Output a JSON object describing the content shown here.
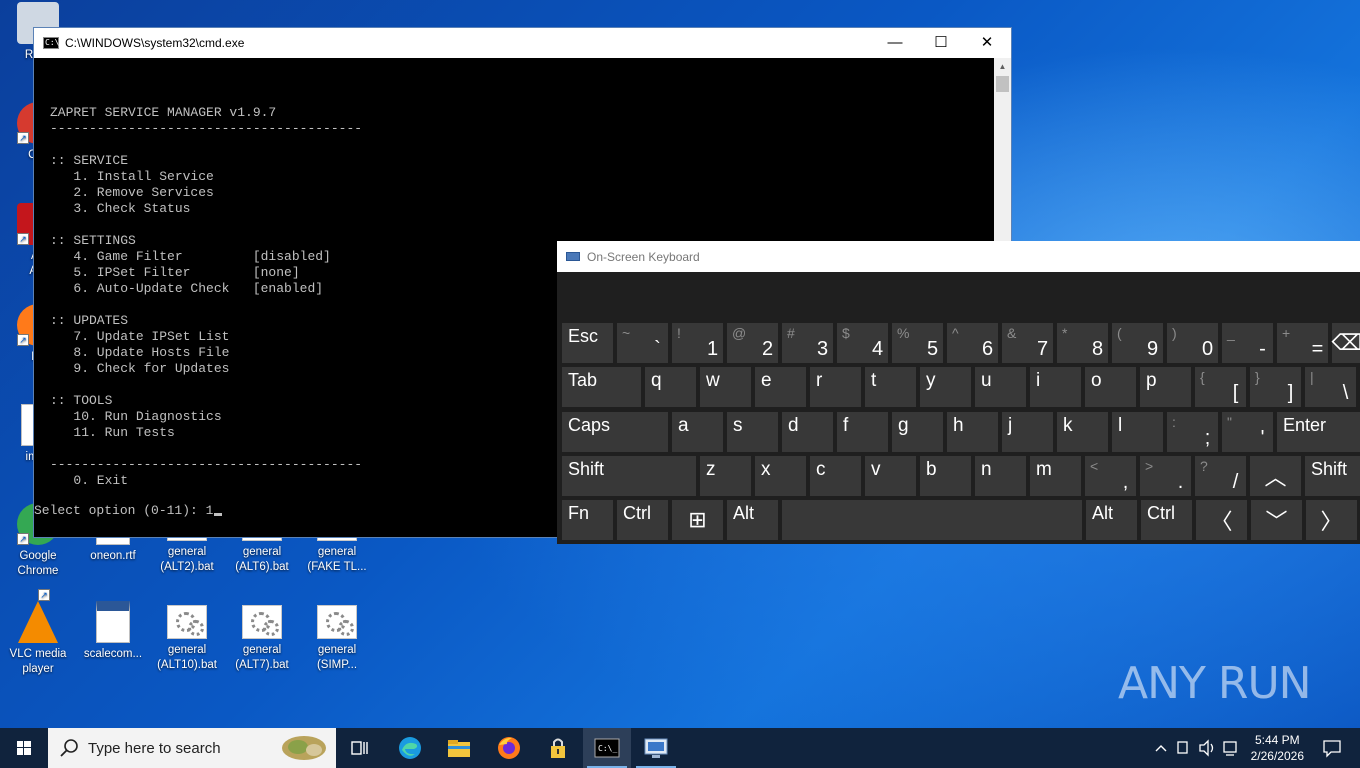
{
  "desktop": {
    "icons": [
      {
        "name": "recycle-bin",
        "label": "Recy",
        "type": "recycle"
      },
      {
        "name": "ccleaner",
        "label": "CCI",
        "type": "app"
      },
      {
        "name": "adobe-acrobat",
        "label": "Ad\nAcr",
        "type": "app"
      },
      {
        "name": "firefox",
        "label": "Fir",
        "type": "app"
      },
      {
        "name": "impo",
        "label": "impo",
        "type": "doc"
      },
      {
        "name": "google-chrome",
        "label": "Google\nChrome",
        "type": "app"
      },
      {
        "name": "oneon-rtf",
        "label": "oneon.rtf",
        "type": "doc"
      },
      {
        "name": "general-alt2",
        "label": "general\n(ALT2).bat",
        "type": "bat"
      },
      {
        "name": "general-alt6",
        "label": "general\n(ALT6).bat",
        "type": "bat"
      },
      {
        "name": "general-fake-tl",
        "label": "general\n(FAKE TL...",
        "type": "bat"
      },
      {
        "name": "vlc",
        "label": "VLC media\nplayer",
        "type": "app"
      },
      {
        "name": "scalecom",
        "label": "scalecom...",
        "type": "word"
      },
      {
        "name": "general-alt10",
        "label": "general\n(ALT10).bat",
        "type": "bat"
      },
      {
        "name": "general-alt7",
        "label": "general\n(ALT7).bat",
        "type": "bat"
      },
      {
        "name": "general-simp",
        "label": "general\n(SIMP...",
        "type": "bat"
      }
    ],
    "watermark": "ANY RUN"
  },
  "cmd": {
    "title": "C:\\WINDOWS\\system32\\cmd.exe",
    "lines": [
      "ZAPRET SERVICE MANAGER v1.9.7",
      "----------------------------------------",
      "",
      ":: SERVICE",
      "   1. Install Service",
      "   2. Remove Services",
      "   3. Check Status",
      "",
      ":: SETTINGS",
      "   4. Game Filter         [disabled]",
      "   5. IPSet Filter        [none]",
      "   6. Auto-Update Check   [enabled]",
      "",
      ":: UPDATES",
      "   7. Update IPSet List",
      "   8. Update Hosts File",
      "   9. Check for Updates",
      "",
      ":: TOOLS",
      "   10. Run Diagnostics",
      "   11. Run Tests",
      "",
      "----------------------------------------",
      "   0. Exit"
    ],
    "prompt": "Select option (0-11): ",
    "input_value": "1"
  },
  "osk": {
    "title": "On-Screen Keyboard",
    "rows": [
      [
        {
          "id": "esc",
          "main": "Esc"
        },
        {
          "id": "backtick",
          "top": "~",
          "bot": "`"
        },
        {
          "id": "1",
          "top": "!",
          "bot": "1"
        },
        {
          "id": "2",
          "top": "@",
          "bot": "2"
        },
        {
          "id": "3",
          "top": "#",
          "bot": "3"
        },
        {
          "id": "4",
          "top": "$",
          "bot": "4"
        },
        {
          "id": "5",
          "top": "%",
          "bot": "5"
        },
        {
          "id": "6",
          "top": "^",
          "bot": "6"
        },
        {
          "id": "7",
          "top": "&",
          "bot": "7"
        },
        {
          "id": "8",
          "top": "*",
          "bot": "8"
        },
        {
          "id": "9",
          "top": "(",
          "bot": "9"
        },
        {
          "id": "0",
          "top": ")",
          "bot": "0"
        },
        {
          "id": "minus",
          "top": "_",
          "bot": "-"
        },
        {
          "id": "equals",
          "top": "+",
          "bot": "="
        },
        {
          "id": "backspace",
          "glyph": "⌫"
        }
      ],
      [
        {
          "id": "tab",
          "main": "Tab"
        },
        {
          "id": "q",
          "main": "q"
        },
        {
          "id": "w",
          "main": "w"
        },
        {
          "id": "e",
          "main": "e"
        },
        {
          "id": "r",
          "main": "r"
        },
        {
          "id": "t",
          "main": "t"
        },
        {
          "id": "y",
          "main": "y"
        },
        {
          "id": "u",
          "main": "u"
        },
        {
          "id": "i",
          "main": "i"
        },
        {
          "id": "o",
          "main": "o"
        },
        {
          "id": "p",
          "main": "p"
        },
        {
          "id": "lbracket",
          "top": "{",
          "bot": "["
        },
        {
          "id": "rbracket",
          "top": "}",
          "bot": "]"
        },
        {
          "id": "backslash",
          "top": "|",
          "bot": "\\"
        }
      ],
      [
        {
          "id": "caps",
          "main": "Caps"
        },
        {
          "id": "a",
          "main": "a"
        },
        {
          "id": "s",
          "main": "s"
        },
        {
          "id": "d",
          "main": "d"
        },
        {
          "id": "f",
          "main": "f"
        },
        {
          "id": "g",
          "main": "g"
        },
        {
          "id": "h",
          "main": "h"
        },
        {
          "id": "j",
          "main": "j"
        },
        {
          "id": "k",
          "main": "k"
        },
        {
          "id": "l",
          "main": "l"
        },
        {
          "id": "semicolon",
          "top": ":",
          "bot": ";"
        },
        {
          "id": "quote",
          "top": "\"",
          "bot": "'"
        },
        {
          "id": "enter",
          "main": "Enter"
        }
      ],
      [
        {
          "id": "lshift",
          "main": "Shift"
        },
        {
          "id": "z",
          "main": "z"
        },
        {
          "id": "x",
          "main": "x"
        },
        {
          "id": "c",
          "main": "c"
        },
        {
          "id": "v",
          "main": "v"
        },
        {
          "id": "b",
          "main": "b"
        },
        {
          "id": "n",
          "main": "n"
        },
        {
          "id": "m",
          "main": "m"
        },
        {
          "id": "comma",
          "top": "<",
          "bot": ","
        },
        {
          "id": "period",
          "top": ">",
          "bot": "."
        },
        {
          "id": "slash",
          "top": "?",
          "bot": "/"
        },
        {
          "id": "up",
          "glyph": "︿"
        },
        {
          "id": "rshift",
          "main": "Shift"
        }
      ],
      [
        {
          "id": "fn",
          "main": "Fn"
        },
        {
          "id": "lctrl",
          "main": "Ctrl"
        },
        {
          "id": "win",
          "glyph": "⊞"
        },
        {
          "id": "lalt",
          "main": "Alt"
        },
        {
          "id": "space",
          "main": ""
        },
        {
          "id": "ralt",
          "main": "Alt"
        },
        {
          "id": "rctrl",
          "main": "Ctrl"
        },
        {
          "id": "left",
          "glyph": "〈"
        },
        {
          "id": "down",
          "glyph": "﹀"
        },
        {
          "id": "right",
          "glyph": "〉"
        }
      ]
    ]
  },
  "taskbar": {
    "search_placeholder": "Type here to search",
    "items": [
      "task-view",
      "edge",
      "file-explorer",
      "firefox",
      "lock-app",
      "cmd",
      "remote-desktop"
    ],
    "clock_time": "5:44 PM",
    "clock_date": "2/26/2026"
  },
  "colors": {
    "osk_key": "#383838",
    "osk_bg": "#1f1f1f",
    "taskbar": "#10233d",
    "console_text": "#c0c0c0"
  }
}
